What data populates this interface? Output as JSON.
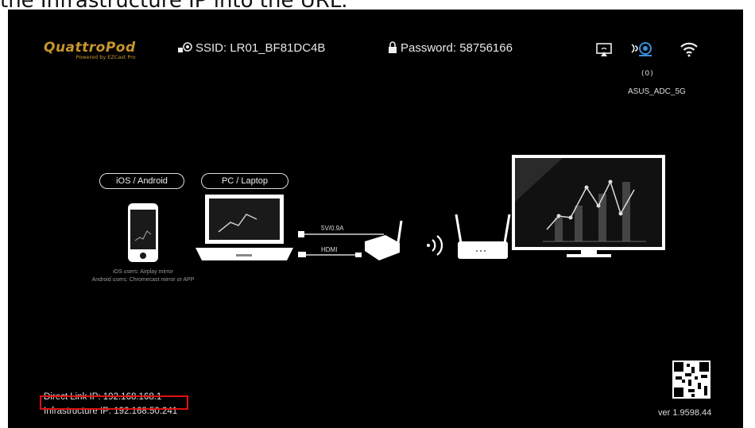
{
  "caption": {
    "text": "the Infrastructure IP  into the URL."
  },
  "header": {
    "brand": "QuattroPod",
    "brand_sub": "Powered by EZCast Pro",
    "ssid": "SSID: LR01_BF81DC4B",
    "password": "Password: 58756166",
    "network_name": "ASUS_ADC_5G",
    "connection_count": "(0)"
  },
  "diagram": {
    "ios_label": "iOS / Android",
    "pc_label": "PC / Laptop",
    "ios_note_line1": "iOS users: Airplay mirror",
    "ios_note_line2": "Android users: Chromecast mirror or APP",
    "usb_label": "5V/0.9A",
    "hdmi_label": "HDMI"
  },
  "footer": {
    "direct_ip": "Direct Link IP: 192.168.168.1",
    "infra_ip": "Infrastructure IP: 192.168.50.241",
    "version": "ver 1.9598.44"
  },
  "colors": {
    "brand": "#c8962e",
    "highlight": "#e01010",
    "background": "#000000"
  }
}
